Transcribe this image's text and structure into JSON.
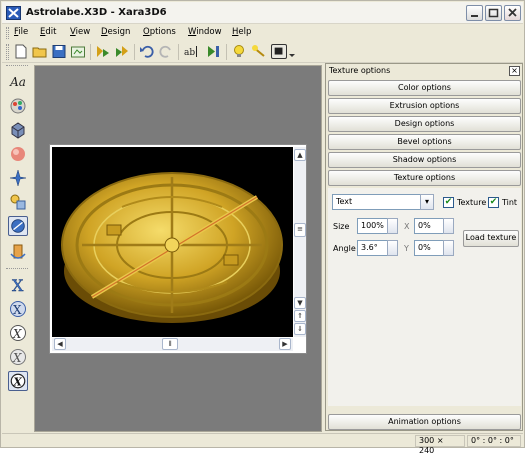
{
  "window": {
    "title": "Astrolabe.X3D - Xara3D6"
  },
  "menu": [
    "File",
    "Edit",
    "View",
    "Design",
    "Options",
    "Window",
    "Help"
  ],
  "menu_underline": [
    "F",
    "E",
    "V",
    "D",
    "O",
    "W",
    "H"
  ],
  "menu_rest": [
    "ile",
    "dit",
    "iew",
    "esign",
    "ptions",
    "indow",
    "elp"
  ],
  "toolbar": {
    "icons": [
      "new-file-icon",
      "open-folder-icon",
      "save-icon",
      "export-icon",
      "design-next-icon",
      "design-prev-icon",
      "undo-icon",
      "redo-icon",
      "text-edit-icon",
      "play-animation-icon",
      "light-bulb-icon",
      "light-tool-icon",
      "view-frame-icon"
    ]
  },
  "left_tools": {
    "text_tool_label": "Aa"
  },
  "panel": {
    "title": "Texture options",
    "sections": [
      "Color options",
      "Extrusion options",
      "Design options",
      "Bevel options",
      "Shadow options",
      "Texture options"
    ],
    "texture_select": "Text",
    "texture_checkbox_label": "Texture",
    "tint_checkbox_label": "Tint",
    "size_label": "Size",
    "size_value": "100%",
    "x_label": "X",
    "x_value": "0%",
    "angle_label": "Angle",
    "angle_value": "3.6°",
    "y_label": "Y",
    "y_value": "0%",
    "load_texture_label": "Load texture",
    "animation_options_label": "Animation options"
  },
  "status": {
    "dimensions": "300 × 240",
    "angles": "0° : 0° : 0°"
  },
  "colors": {
    "gold": "#c9a020",
    "titlebar": "#f4f3ee",
    "panel_bg": "#ece9d8",
    "viewport_bg": "#7b7b7b"
  }
}
